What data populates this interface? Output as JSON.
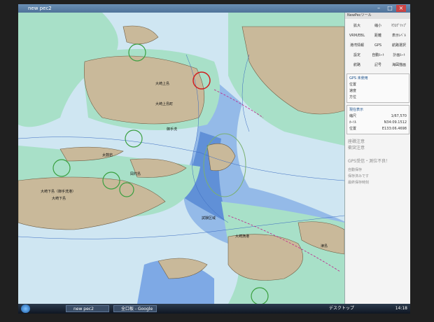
{
  "window": {
    "title": "new pec2",
    "min": "–",
    "max": "□",
    "close": "×"
  },
  "map_labels": {
    "island_a": "大崎上島",
    "island_b": "大崎上島町",
    "island_c": "大崎下島（御手洗港）",
    "island_d": "大崎下島",
    "island_e": "岡村島",
    "island_f": "津島",
    "place_1": "御手洗",
    "place_2": "太鼓岩",
    "place_3": "大崎漁港",
    "buoy_tag": "試験区域"
  },
  "panel": {
    "title": "NewPecツール",
    "buttons": [
      "拡大",
      "縮小",
      "ﾏｳｽｸﾞﾘｯﾌﾟ",
      "VRM/EBL",
      "距離",
      "表示ﾚﾍﾞﾙ",
      "港湾情報",
      "GPS",
      "航路選択",
      "設定",
      "自動ﾙｰﾄ",
      "計画ﾙｰﾄ",
      "航路",
      "記号",
      "海図描画"
    ],
    "gps_head": "GPS 未使用",
    "gps_rows": [
      [
        "位置",
        ""
      ],
      [
        "速度",
        ""
      ],
      [
        "方位",
        ""
      ]
    ],
    "chart_head": "現在表示",
    "chart_rows": [
      [
        "縮尺",
        "1/67,570"
      ],
      [
        "ｶｰｿﾙ",
        "N34:09.1512"
      ],
      [
        "位置",
        "E133:06.4698"
      ]
    ],
    "warn1": "座礁注意",
    "warn2": "衝突注意",
    "warn3": "GPS受信・測位不良！",
    "warn4": "自動保存",
    "warn5": "保存済みです",
    "warn6": "最終保存時刻"
  },
  "taskbar": {
    "item1": "new pec2",
    "item2": "全口板 - Google ...",
    "desktop": "デスクトップ",
    "clock": "14:18"
  },
  "colors": {
    "land": "#c9b99a",
    "shallow": "#a8e0c8",
    "deep": "#4a7fd0",
    "sea": "#cfe6f2"
  }
}
